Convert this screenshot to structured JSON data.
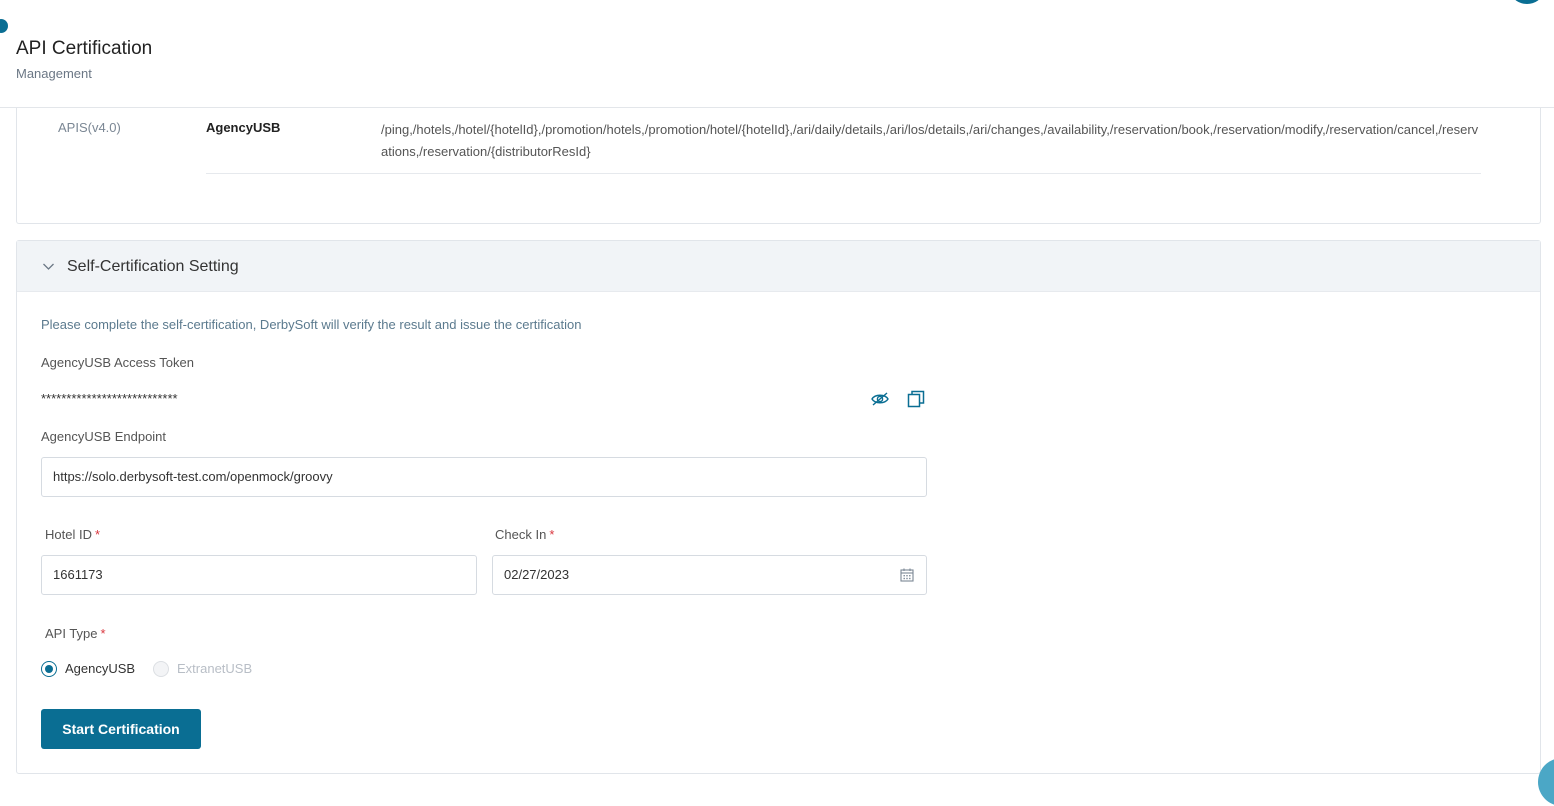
{
  "header": {
    "title": "API Certification",
    "subtitle": "Management"
  },
  "api_section": {
    "label": "APIS(v4.0)",
    "name": "AgencyUSB",
    "paths": "/ping,/hotels,/hotel/{hotelId},/promotion/hotels,/promotion/hotel/{hotelId},/ari/daily/details,/ari/los/details,/ari/changes,/availability,/reservation/book,/reservation/modify,/reservation/cancel,/reservations,/reservation/{distributorResId}"
  },
  "self_cert": {
    "title": "Self-Certification Setting",
    "notice": "Please complete the self-certification, DerbySoft will verify the result and issue the certification",
    "token_label": "AgencyUSB Access Token",
    "token_value": "***************************",
    "endpoint_label": "AgencyUSB Endpoint",
    "endpoint_value": "https://solo.derbysoft-test.com/openmock/groovy",
    "hotel_id_label": "Hotel ID",
    "hotel_id_value": "1661173",
    "check_in_label": "Check In",
    "check_in_value": "02/27/2023",
    "required_mark": "*",
    "api_type_label": "API Type",
    "api_type_options": [
      "AgencyUSB",
      "ExtranetUSB"
    ],
    "api_type_selected": "AgencyUSB",
    "start_button": "Start Certification"
  },
  "colors": {
    "primary": "#0a6e93",
    "required": "#d9363e",
    "header_bg": "#f1f4f7"
  },
  "icons": {
    "toggle_visibility": "eye-slash-icon",
    "copy": "copy-icon",
    "calendar": "calendar-icon",
    "collapse": "chevron-down-icon"
  }
}
